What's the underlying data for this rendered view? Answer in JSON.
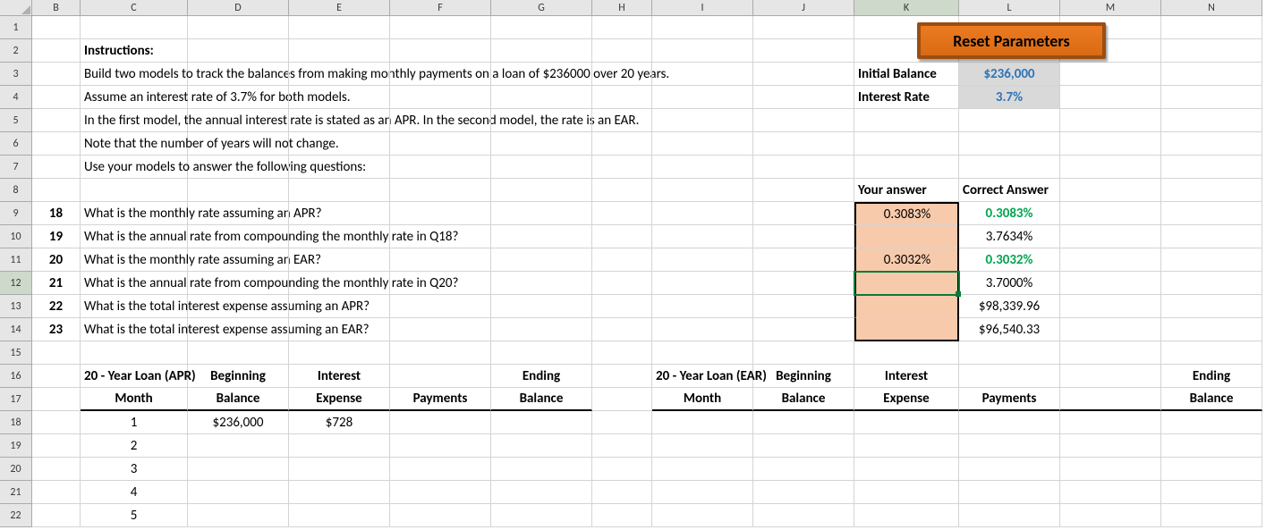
{
  "columns": [
    "B",
    "C",
    "D",
    "E",
    "F",
    "G",
    "H",
    "I",
    "J",
    "K",
    "L",
    "M",
    "N"
  ],
  "colWidths": {
    "B": 54,
    "C": 120,
    "D": 113,
    "E": 113,
    "F": 113,
    "G": 113,
    "H": 67,
    "I": 113,
    "J": 113,
    "K": 117,
    "L": 113,
    "M": 113,
    "N": 113
  },
  "rowNumbers": [
    1,
    2,
    3,
    4,
    5,
    6,
    7,
    8,
    9,
    10,
    11,
    12,
    13,
    14,
    15,
    16,
    17,
    18,
    19,
    20,
    21,
    22
  ],
  "activeCell": {
    "row": 12,
    "col": "K"
  },
  "button": {
    "label": "Reset Parameters"
  },
  "instructions": {
    "title": "Instructions:",
    "lines": [
      "Build two models to track the balances from making monthly payments on a loan of $236000 over 20 years.",
      "Assume an interest rate of 3.7% for both models.",
      "In the first model, the annual interest rate is stated as an APR. In the second model, the rate is an EAR.",
      "Note that the number of years will not change.",
      "Use your models to answer the following questions:"
    ]
  },
  "params": {
    "label_balance": "Initial Balance",
    "value_balance": "$236,000",
    "label_rate": "Interest Rate",
    "value_rate": "3.7%"
  },
  "answerHeaders": {
    "your": "Your answer",
    "correct": "Correct Answer"
  },
  "questions": [
    {
      "num": "18",
      "text": "What is the monthly rate assuming an APR?",
      "your": "0.3083%",
      "correct": "0.3083%",
      "correctGreen": true
    },
    {
      "num": "19",
      "text": "What is the annual rate from compounding the monthly rate in Q18?",
      "your": "",
      "correct": "3.7634%",
      "correctGreen": false
    },
    {
      "num": "20",
      "text": "What is the monthly rate assuming an EAR?",
      "your": "0.3032%",
      "correct": "0.3032%",
      "correctGreen": true
    },
    {
      "num": "21",
      "text": "What is the annual rate from compounding the monthly rate in Q20?",
      "your": "",
      "correct": "3.7000%",
      "correctGreen": false
    },
    {
      "num": "22",
      "text": "What is the total interest expense assuming an APR?",
      "your": "",
      "correct": "$98,339.96",
      "correctGreen": false
    },
    {
      "num": "23",
      "text": "What is the total interest expense assuming an EAR?",
      "your": "",
      "correct": "$96,540.33",
      "correctGreen": false
    }
  ],
  "tables": {
    "apr": {
      "title": "20 - Year Loan (APR)",
      "headers": {
        "top": {
          "beg": "Beginning",
          "int": "Interest",
          "end": "Ending"
        },
        "bot": {
          "month": "Month",
          "beg": "Balance",
          "int": "Expense",
          "pay": "Payments",
          "end": "Balance"
        }
      },
      "rows": [
        {
          "month": "1",
          "beg": "$236,000",
          "int": "$728",
          "pay": "",
          "end": ""
        },
        {
          "month": "2",
          "beg": "",
          "int": "",
          "pay": "",
          "end": ""
        },
        {
          "month": "3",
          "beg": "",
          "int": "",
          "pay": "",
          "end": ""
        },
        {
          "month": "4",
          "beg": "",
          "int": "",
          "pay": "",
          "end": ""
        },
        {
          "month": "5",
          "beg": "",
          "int": "",
          "pay": "",
          "end": ""
        }
      ]
    },
    "ear": {
      "title": "20 - Year Loan (EAR)",
      "headers": {
        "top": {
          "beg": "Beginning",
          "int": "Interest",
          "end": "Ending"
        },
        "bot": {
          "month": "Month",
          "beg": "Balance",
          "int": "Expense",
          "pay": "Payments",
          "end": "Balance"
        }
      }
    }
  }
}
